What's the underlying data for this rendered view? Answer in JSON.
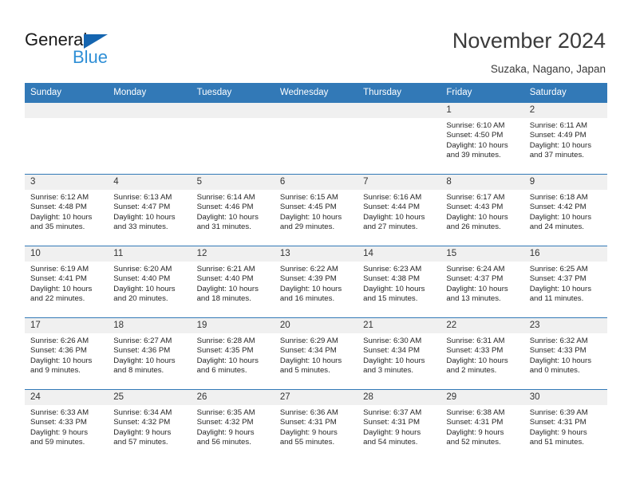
{
  "logo": {
    "word_top": "General",
    "word_bottom": "Blue",
    "triangle_color": "#1565b0",
    "blue_color": "#2f8fd6"
  },
  "header": {
    "title": "November 2024",
    "subtitle": "Suzaka, Nagano, Japan",
    "accent_color": "#3279b7",
    "daynum_bg": "#f0f0f0"
  },
  "calendar": {
    "weekday_headers": [
      "Sunday",
      "Monday",
      "Tuesday",
      "Wednesday",
      "Thursday",
      "Friday",
      "Saturday"
    ],
    "weeks": [
      [
        {
          "day": "",
          "sunrise": "",
          "sunset": "",
          "daylight": "",
          "daylight2": "",
          "empty": true
        },
        {
          "day": "",
          "sunrise": "",
          "sunset": "",
          "daylight": "",
          "daylight2": "",
          "empty": true
        },
        {
          "day": "",
          "sunrise": "",
          "sunset": "",
          "daylight": "",
          "daylight2": "",
          "empty": true
        },
        {
          "day": "",
          "sunrise": "",
          "sunset": "",
          "daylight": "",
          "daylight2": "",
          "empty": true
        },
        {
          "day": "",
          "sunrise": "",
          "sunset": "",
          "daylight": "",
          "daylight2": "",
          "empty": true
        },
        {
          "day": "1",
          "sunrise": "Sunrise: 6:10 AM",
          "sunset": "Sunset: 4:50 PM",
          "daylight": "Daylight: 10 hours",
          "daylight2": "and 39 minutes.",
          "empty": false
        },
        {
          "day": "2",
          "sunrise": "Sunrise: 6:11 AM",
          "sunset": "Sunset: 4:49 PM",
          "daylight": "Daylight: 10 hours",
          "daylight2": "and 37 minutes.",
          "empty": false
        }
      ],
      [
        {
          "day": "3",
          "sunrise": "Sunrise: 6:12 AM",
          "sunset": "Sunset: 4:48 PM",
          "daylight": "Daylight: 10 hours",
          "daylight2": "and 35 minutes.",
          "empty": false
        },
        {
          "day": "4",
          "sunrise": "Sunrise: 6:13 AM",
          "sunset": "Sunset: 4:47 PM",
          "daylight": "Daylight: 10 hours",
          "daylight2": "and 33 minutes.",
          "empty": false
        },
        {
          "day": "5",
          "sunrise": "Sunrise: 6:14 AM",
          "sunset": "Sunset: 4:46 PM",
          "daylight": "Daylight: 10 hours",
          "daylight2": "and 31 minutes.",
          "empty": false
        },
        {
          "day": "6",
          "sunrise": "Sunrise: 6:15 AM",
          "sunset": "Sunset: 4:45 PM",
          "daylight": "Daylight: 10 hours",
          "daylight2": "and 29 minutes.",
          "empty": false
        },
        {
          "day": "7",
          "sunrise": "Sunrise: 6:16 AM",
          "sunset": "Sunset: 4:44 PM",
          "daylight": "Daylight: 10 hours",
          "daylight2": "and 27 minutes.",
          "empty": false
        },
        {
          "day": "8",
          "sunrise": "Sunrise: 6:17 AM",
          "sunset": "Sunset: 4:43 PM",
          "daylight": "Daylight: 10 hours",
          "daylight2": "and 26 minutes.",
          "empty": false
        },
        {
          "day": "9",
          "sunrise": "Sunrise: 6:18 AM",
          "sunset": "Sunset: 4:42 PM",
          "daylight": "Daylight: 10 hours",
          "daylight2": "and 24 minutes.",
          "empty": false
        }
      ],
      [
        {
          "day": "10",
          "sunrise": "Sunrise: 6:19 AM",
          "sunset": "Sunset: 4:41 PM",
          "daylight": "Daylight: 10 hours",
          "daylight2": "and 22 minutes.",
          "empty": false
        },
        {
          "day": "11",
          "sunrise": "Sunrise: 6:20 AM",
          "sunset": "Sunset: 4:40 PM",
          "daylight": "Daylight: 10 hours",
          "daylight2": "and 20 minutes.",
          "empty": false
        },
        {
          "day": "12",
          "sunrise": "Sunrise: 6:21 AM",
          "sunset": "Sunset: 4:40 PM",
          "daylight": "Daylight: 10 hours",
          "daylight2": "and 18 minutes.",
          "empty": false
        },
        {
          "day": "13",
          "sunrise": "Sunrise: 6:22 AM",
          "sunset": "Sunset: 4:39 PM",
          "daylight": "Daylight: 10 hours",
          "daylight2": "and 16 minutes.",
          "empty": false
        },
        {
          "day": "14",
          "sunrise": "Sunrise: 6:23 AM",
          "sunset": "Sunset: 4:38 PM",
          "daylight": "Daylight: 10 hours",
          "daylight2": "and 15 minutes.",
          "empty": false
        },
        {
          "day": "15",
          "sunrise": "Sunrise: 6:24 AM",
          "sunset": "Sunset: 4:37 PM",
          "daylight": "Daylight: 10 hours",
          "daylight2": "and 13 minutes.",
          "empty": false
        },
        {
          "day": "16",
          "sunrise": "Sunrise: 6:25 AM",
          "sunset": "Sunset: 4:37 PM",
          "daylight": "Daylight: 10 hours",
          "daylight2": "and 11 minutes.",
          "empty": false
        }
      ],
      [
        {
          "day": "17",
          "sunrise": "Sunrise: 6:26 AM",
          "sunset": "Sunset: 4:36 PM",
          "daylight": "Daylight: 10 hours",
          "daylight2": "and 9 minutes.",
          "empty": false
        },
        {
          "day": "18",
          "sunrise": "Sunrise: 6:27 AM",
          "sunset": "Sunset: 4:36 PM",
          "daylight": "Daylight: 10 hours",
          "daylight2": "and 8 minutes.",
          "empty": false
        },
        {
          "day": "19",
          "sunrise": "Sunrise: 6:28 AM",
          "sunset": "Sunset: 4:35 PM",
          "daylight": "Daylight: 10 hours",
          "daylight2": "and 6 minutes.",
          "empty": false
        },
        {
          "day": "20",
          "sunrise": "Sunrise: 6:29 AM",
          "sunset": "Sunset: 4:34 PM",
          "daylight": "Daylight: 10 hours",
          "daylight2": "and 5 minutes.",
          "empty": false
        },
        {
          "day": "21",
          "sunrise": "Sunrise: 6:30 AM",
          "sunset": "Sunset: 4:34 PM",
          "daylight": "Daylight: 10 hours",
          "daylight2": "and 3 minutes.",
          "empty": false
        },
        {
          "day": "22",
          "sunrise": "Sunrise: 6:31 AM",
          "sunset": "Sunset: 4:33 PM",
          "daylight": "Daylight: 10 hours",
          "daylight2": "and 2 minutes.",
          "empty": false
        },
        {
          "day": "23",
          "sunrise": "Sunrise: 6:32 AM",
          "sunset": "Sunset: 4:33 PM",
          "daylight": "Daylight: 10 hours",
          "daylight2": "and 0 minutes.",
          "empty": false
        }
      ],
      [
        {
          "day": "24",
          "sunrise": "Sunrise: 6:33 AM",
          "sunset": "Sunset: 4:33 PM",
          "daylight": "Daylight: 9 hours",
          "daylight2": "and 59 minutes.",
          "empty": false
        },
        {
          "day": "25",
          "sunrise": "Sunrise: 6:34 AM",
          "sunset": "Sunset: 4:32 PM",
          "daylight": "Daylight: 9 hours",
          "daylight2": "and 57 minutes.",
          "empty": false
        },
        {
          "day": "26",
          "sunrise": "Sunrise: 6:35 AM",
          "sunset": "Sunset: 4:32 PM",
          "daylight": "Daylight: 9 hours",
          "daylight2": "and 56 minutes.",
          "empty": false
        },
        {
          "day": "27",
          "sunrise": "Sunrise: 6:36 AM",
          "sunset": "Sunset: 4:31 PM",
          "daylight": "Daylight: 9 hours",
          "daylight2": "and 55 minutes.",
          "empty": false
        },
        {
          "day": "28",
          "sunrise": "Sunrise: 6:37 AM",
          "sunset": "Sunset: 4:31 PM",
          "daylight": "Daylight: 9 hours",
          "daylight2": "and 54 minutes.",
          "empty": false
        },
        {
          "day": "29",
          "sunrise": "Sunrise: 6:38 AM",
          "sunset": "Sunset: 4:31 PM",
          "daylight": "Daylight: 9 hours",
          "daylight2": "and 52 minutes.",
          "empty": false
        },
        {
          "day": "30",
          "sunrise": "Sunrise: 6:39 AM",
          "sunset": "Sunset: 4:31 PM",
          "daylight": "Daylight: 9 hours",
          "daylight2": "and 51 minutes.",
          "empty": false
        }
      ]
    ]
  }
}
